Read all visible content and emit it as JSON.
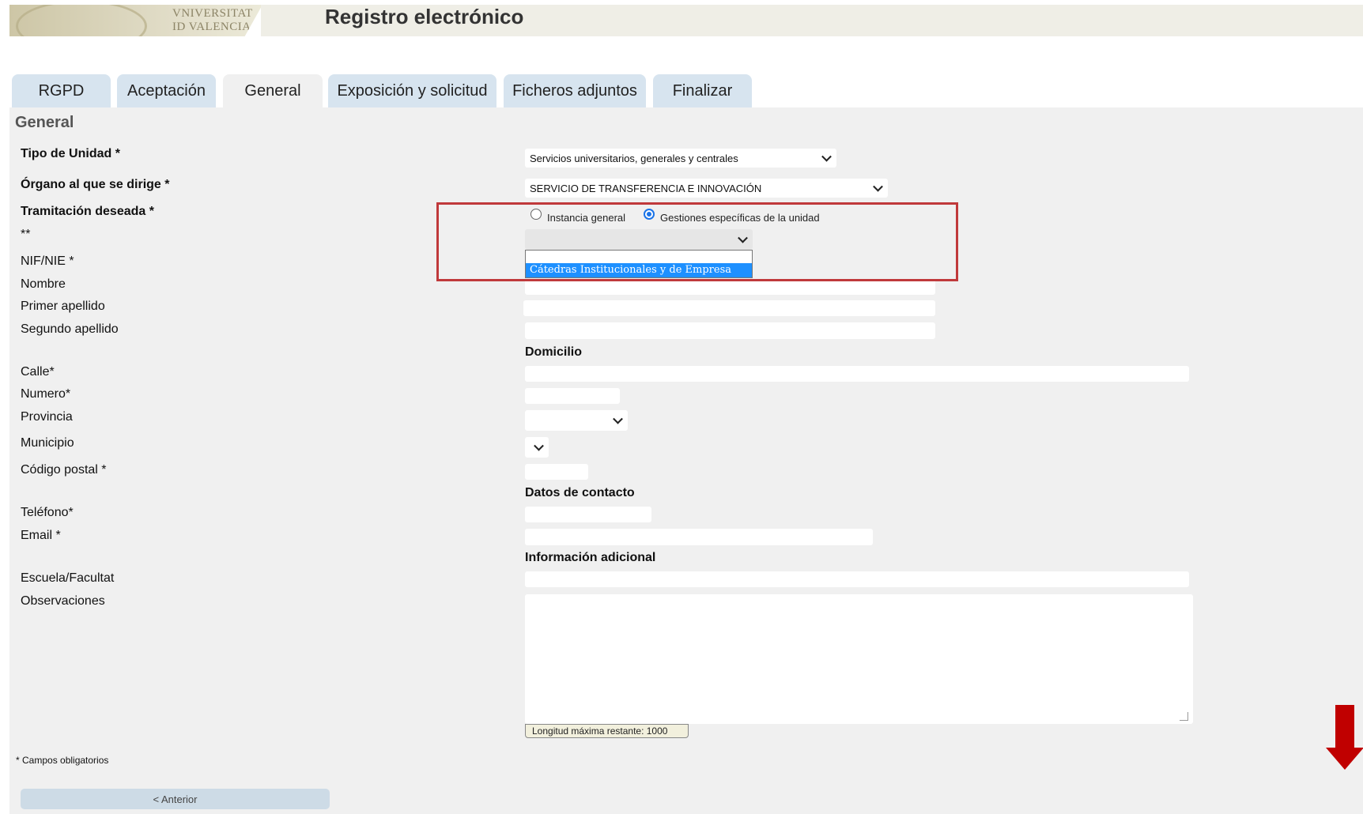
{
  "header": {
    "logo_text_line1": "VNIVERSITAT",
    "logo_text_line2": "ID VALENCIA",
    "title": "Registro electrónico"
  },
  "tabs": [
    {
      "label": "RGPD",
      "active": false
    },
    {
      "label": "Aceptación",
      "active": false
    },
    {
      "label": "General",
      "active": true
    },
    {
      "label": "Exposición y solicitud",
      "active": false
    },
    {
      "label": "Ficheros adjuntos",
      "active": false
    },
    {
      "label": "Finalizar",
      "active": false
    }
  ],
  "section": {
    "title": "General"
  },
  "form": {
    "tipo_unidad": {
      "label": "Tipo de Unidad *",
      "value": "Servicios universitarios, generales y centrales"
    },
    "organo": {
      "label": "Órgano al que se dirige *",
      "value": "SERVICIO DE TRANSFERENCIA E INNOVACIÓN"
    },
    "tramitacion": {
      "label": "Tramitación deseada *",
      "options": [
        {
          "label": "Instancia general",
          "selected": false
        },
        {
          "label": "Gestiones específicas de la unidad",
          "selected": true
        }
      ]
    },
    "double_star_label": "**",
    "dropdown": {
      "options": [
        "",
        "Cátedras Institucionales y de Empresa"
      ],
      "highlighted": "Cátedras Institucionales y de Empresa"
    },
    "nif_label": "NIF/NIE *",
    "nombre_label": "Nombre",
    "primer_apellido_label": "Primer apellido",
    "segundo_apellido_label": "Segundo apellido",
    "domicilio_heading": "Domicilio",
    "calle_label": "Calle*",
    "numero_label": "Numero*",
    "provincia_label": "Provincia",
    "municipio_label": "Municipio",
    "codigo_postal_label": "Código postal *",
    "contacto_heading": "Datos de contacto",
    "telefono_label": "Teléfono*",
    "email_label": "Email *",
    "info_heading": "Información adicional",
    "escuela_label": "Escuela/Facultat",
    "observaciones_label": "Observaciones",
    "counter_text": "Longitud máxima restante: 1000"
  },
  "footer": {
    "required_note": "* Campos obligatorios",
    "prev_button": "< Anterior"
  },
  "colors": {
    "tab_bg": "#d7e4ef",
    "panel_bg": "#f0f0f0",
    "highlight_border": "#c0393b",
    "selected_option": "#1e90ff",
    "arrow": "#c00000"
  }
}
